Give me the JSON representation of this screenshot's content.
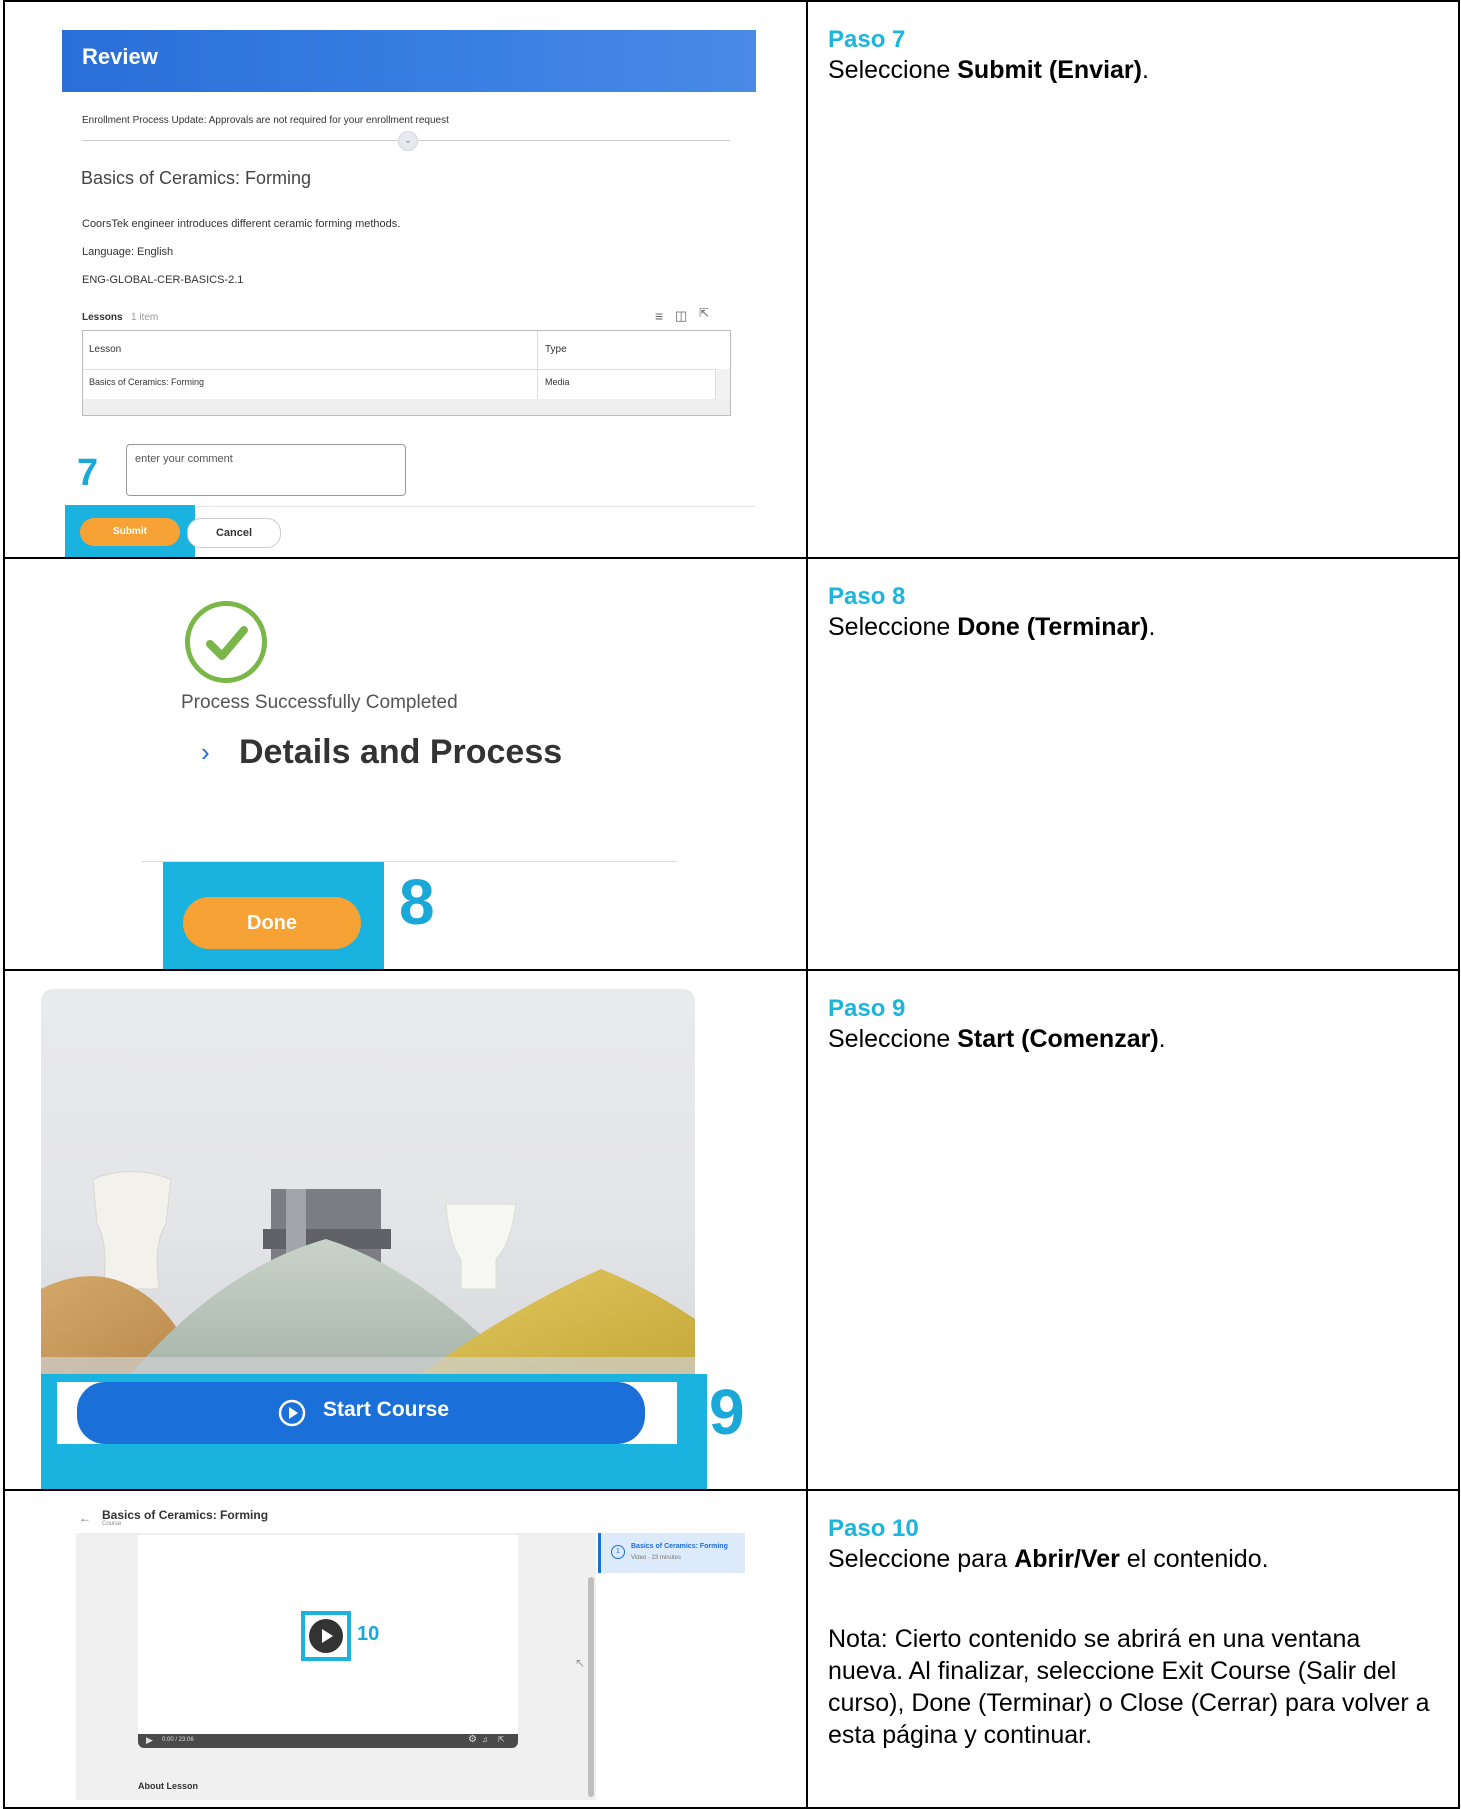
{
  "steps": [
    {
      "title": "Paso 7",
      "text_pre": "Seleccione ",
      "text_bold": "Submit (Enviar)",
      "text_post": ".",
      "screenshot": {
        "header": "Review",
        "notice": "Enrollment Process Update: Approvals are not required for your enrollment request",
        "course_title": "Basics of Ceramics: Forming",
        "description": "CoorsTek engineer introduces different ceramic forming methods.",
        "language": "Language: English",
        "code": "ENG-GLOBAL-CER-BASICS-2.1",
        "lessons_label": "Lessons",
        "lessons_count": "1 item",
        "table_headers": [
          "Lesson",
          "Type"
        ],
        "table_rows": [
          [
            "Basics of Ceramics: Forming",
            "Media"
          ]
        ],
        "comment_placeholder": "enter your comment",
        "submit_label": "Submit",
        "cancel_label": "Cancel",
        "callout_number": "7"
      }
    },
    {
      "title": "Paso 8",
      "text_pre": "Seleccione ",
      "text_bold": "Done (Terminar)",
      "text_post": ".",
      "screenshot": {
        "success_text": "Process Successfully Completed",
        "details_text": "Details and Process",
        "done_label": "Done",
        "callout_number": "8"
      }
    },
    {
      "title": "Paso 9",
      "text_pre": "Seleccione ",
      "text_bold": "Start (Comenzar)",
      "text_post": ".",
      "screenshot": {
        "start_label": "Start Course",
        "callout_number": "9"
      }
    },
    {
      "title": "Paso 10",
      "text_pre": "Seleccione para ",
      "text_bold": "Abrir/Ver",
      "text_post": " el contenido.",
      "note": "Nota: Cierto contenido se abrirá en una ventana nueva. Al finalizar, seleccione Exit Course (Salir del curso), Done (Terminar) o Close (Cerrar) para volver a esta página y continuar.",
      "screenshot": {
        "course_title": "Basics of Ceramics: Forming",
        "course_sub": "Course",
        "sidebar_item": "Basics of Ceramics: Forming",
        "sidebar_meta": "Video · 23 minutes",
        "sidebar_index": "1",
        "time_readout": "0:00 / 23:06",
        "about_label": "About Lesson",
        "callout_number": "10"
      }
    }
  ],
  "colors": {
    "accent_cyan": "#1bb5dd",
    "brand_blue": "#1a6fd8",
    "button_orange": "#f7a234",
    "success_green": "#7ab648"
  }
}
